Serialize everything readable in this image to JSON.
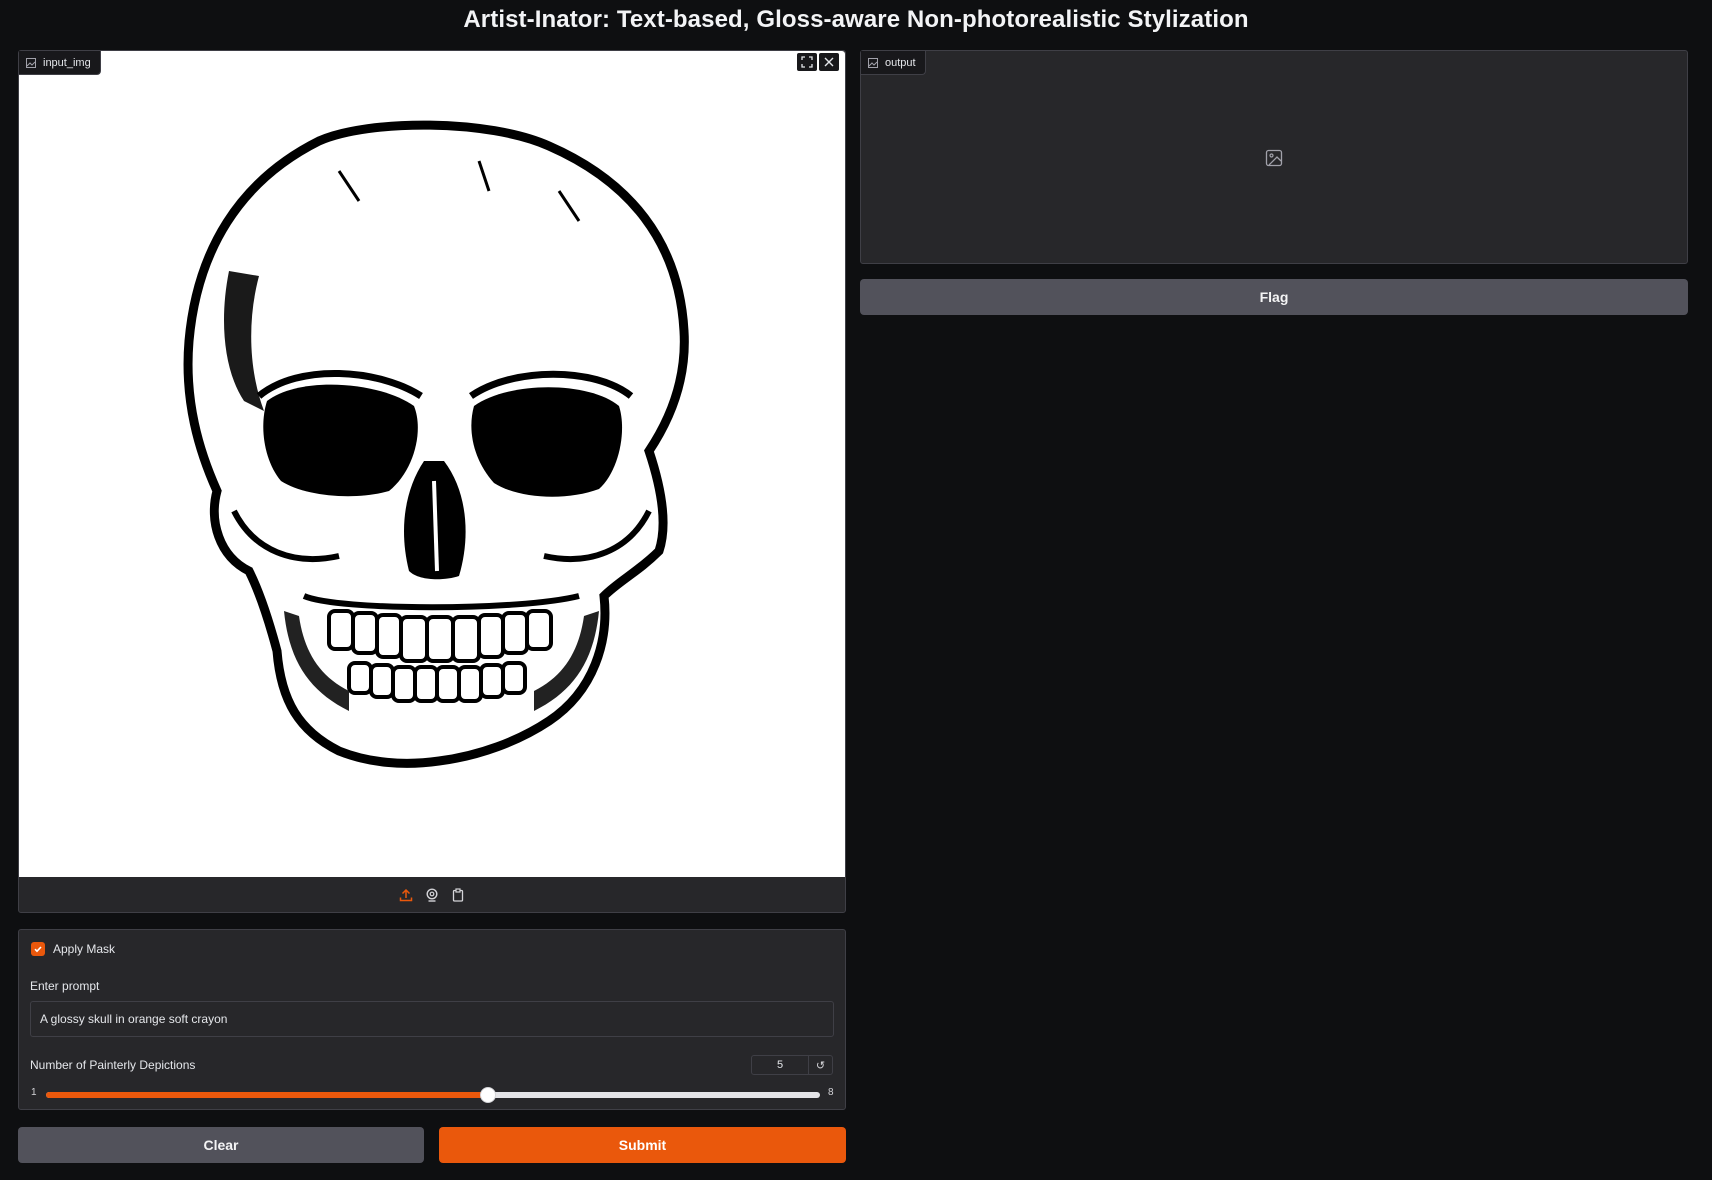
{
  "header": {
    "title": "Artist-Inator: Text-based, Gloss-aware Non-photorealistic Stylization"
  },
  "input_image": {
    "label": "input_img",
    "icon": "image-icon",
    "tools": [
      "fullscreen-icon",
      "close-icon"
    ],
    "sources": [
      "upload-icon",
      "webcam-icon",
      "clipboard-icon"
    ]
  },
  "output_image": {
    "label": "output",
    "placeholder_icon": "image-icon"
  },
  "flag_button": {
    "label": "Flag"
  },
  "controls": {
    "apply_mask": {
      "label": "Apply Mask",
      "checked": true
    },
    "prompt": {
      "label": "Enter prompt",
      "value": "A glossy skull in orange soft crayon"
    },
    "depictions": {
      "label": "Number of Painterly Depictions",
      "value": "5",
      "min": "1",
      "max": "8"
    }
  },
  "buttons": {
    "clear": "Clear",
    "submit": "Submit"
  },
  "colors": {
    "accent": "#ea580c",
    "background": "#0e0f11",
    "panel": "#27272a",
    "secondary_button": "#52525b"
  }
}
